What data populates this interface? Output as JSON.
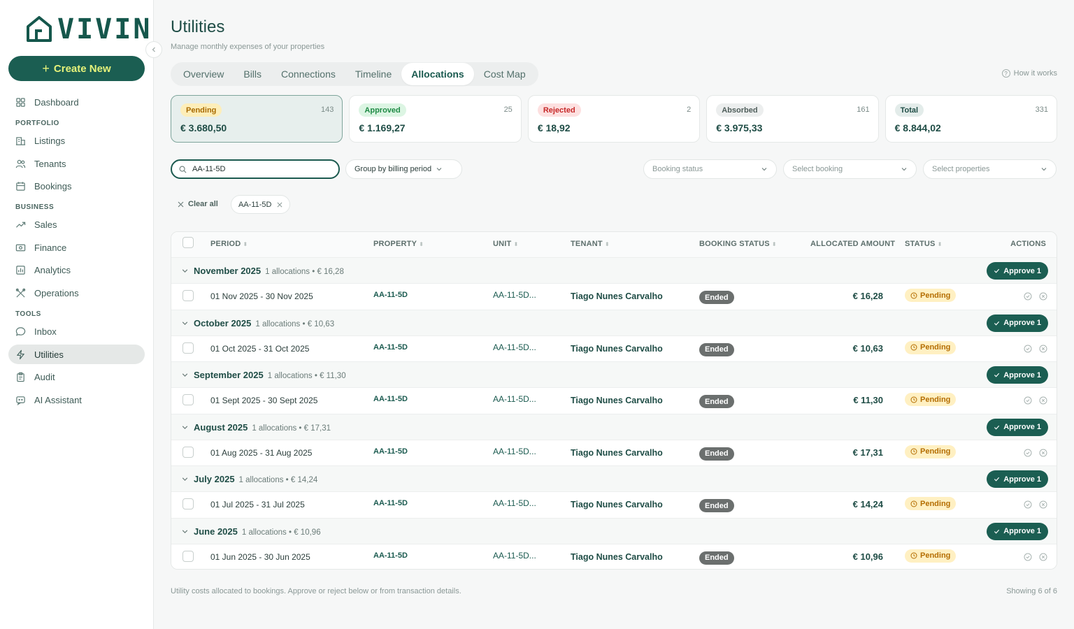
{
  "app": {
    "logo_text": "VIVIN"
  },
  "sidebar": {
    "create_label": "Create New",
    "sections": {
      "portfolio": "PORTFOLIO",
      "business": "BUSINESS",
      "tools": "TOOLS"
    },
    "items": [
      {
        "label": "Dashboard",
        "icon": "grid-icon"
      },
      {
        "label": "Listings",
        "icon": "building-icon"
      },
      {
        "label": "Tenants",
        "icon": "users-icon"
      },
      {
        "label": "Bookings",
        "icon": "calendar-icon"
      },
      {
        "label": "Sales",
        "icon": "trend-icon"
      },
      {
        "label": "Finance",
        "icon": "cash-icon"
      },
      {
        "label": "Analytics",
        "icon": "chart-icon"
      },
      {
        "label": "Operations",
        "icon": "tools-icon"
      },
      {
        "label": "Inbox",
        "icon": "chat-icon"
      },
      {
        "label": "Utilities",
        "icon": "bolt-icon",
        "active": true
      },
      {
        "label": "Audit",
        "icon": "clipboard-icon"
      },
      {
        "label": "AI Assistant",
        "icon": "bot-icon"
      }
    ]
  },
  "header": {
    "title": "Utilities",
    "subtitle": "Manage monthly expenses of your properties",
    "how_it_works": "How it works"
  },
  "tabs": [
    "Overview",
    "Bills",
    "Connections",
    "Timeline",
    "Allocations",
    "Cost Map"
  ],
  "active_tab": "Allocations",
  "stats": [
    {
      "label": "Pending",
      "count": "143",
      "amount": "€ 3.680,50",
      "badge_bg": "#fdeeb9",
      "badge_fg": "#a86a00"
    },
    {
      "label": "Approved",
      "count": "25",
      "amount": "€ 1.169,27",
      "badge_bg": "#dcf5e3",
      "badge_fg": "#1f8a45"
    },
    {
      "label": "Rejected",
      "count": "2",
      "amount": "€ 18,92",
      "badge_bg": "#fde0e0",
      "badge_fg": "#c62828"
    },
    {
      "label": "Absorbed",
      "count": "161",
      "amount": "€ 3.975,33",
      "badge_bg": "#eceeee",
      "badge_fg": "#4f5e5b"
    },
    {
      "label": "Total",
      "count": "331",
      "amount": "€ 8.844,02",
      "badge_bg": "#e3ecea",
      "badge_fg": "#1f4d46"
    }
  ],
  "filters": {
    "search_value": "AA-11-5D",
    "group_by": "Group by billing period",
    "booking_status_placeholder": "Booking status",
    "booking_placeholder": "Select booking",
    "properties_placeholder": "Select properties",
    "clear_all": "Clear all",
    "active_chip": "AA-11-5D"
  },
  "table": {
    "columns": [
      "PERIOD",
      "PROPERTY",
      "UNIT",
      "TENANT",
      "BOOKING STATUS",
      "ALLOCATED AMOUNT",
      "STATUS",
      "ACTIONS"
    ],
    "approve_label": "Approve 1",
    "groups": [
      {
        "title": "November 2025",
        "meta": "1 allocations • € 16,28",
        "row": {
          "period": "01 Nov 2025 - 30 Nov 2025",
          "property": "AA-11-5D",
          "unit": "AA-11-5D...",
          "tenant": "Tiago Nunes Carvalho",
          "booking_status": "Ended",
          "amount": "€ 16,28",
          "status": "Pending"
        }
      },
      {
        "title": "October 2025",
        "meta": "1 allocations • € 10,63",
        "row": {
          "period": "01 Oct 2025 - 31 Oct 2025",
          "property": "AA-11-5D",
          "unit": "AA-11-5D...",
          "tenant": "Tiago Nunes Carvalho",
          "booking_status": "Ended",
          "amount": "€ 10,63",
          "status": "Pending"
        }
      },
      {
        "title": "September 2025",
        "meta": "1 allocations • € 11,30",
        "row": {
          "period": "01 Sept 2025 - 30 Sept 2025",
          "property": "AA-11-5D",
          "unit": "AA-11-5D...",
          "tenant": "Tiago Nunes Carvalho",
          "booking_status": "Ended",
          "amount": "€ 11,30",
          "status": "Pending"
        }
      },
      {
        "title": "August 2025",
        "meta": "1 allocations • € 17,31",
        "row": {
          "period": "01 Aug 2025 - 31 Aug 2025",
          "property": "AA-11-5D",
          "unit": "AA-11-5D...",
          "tenant": "Tiago Nunes Carvalho",
          "booking_status": "Ended",
          "amount": "€ 17,31",
          "status": "Pending"
        }
      },
      {
        "title": "July 2025",
        "meta": "1 allocations • € 14,24",
        "row": {
          "period": "01 Jul 2025 - 31 Jul 2025",
          "property": "AA-11-5D",
          "unit": "AA-11-5D...",
          "tenant": "Tiago Nunes Carvalho",
          "booking_status": "Ended",
          "amount": "€ 14,24",
          "status": "Pending"
        }
      },
      {
        "title": "June 2025",
        "meta": "1 allocations • € 10,96",
        "row": {
          "period": "01 Jun 2025 - 30 Jun 2025",
          "property": "AA-11-5D",
          "unit": "AA-11-5D...",
          "tenant": "Tiago Nunes Carvalho",
          "booking_status": "Ended",
          "amount": "€ 10,96",
          "status": "Pending"
        }
      }
    ]
  },
  "footer": {
    "note": "Utility costs allocated to bookings. Approve or reject below or from transaction details.",
    "count": "Showing 6 of 6"
  },
  "colors": {
    "brand": "#1b5e52",
    "accent": "#e6f27a",
    "pending": "#fff0c2",
    "ended": "#6b6f6e"
  }
}
